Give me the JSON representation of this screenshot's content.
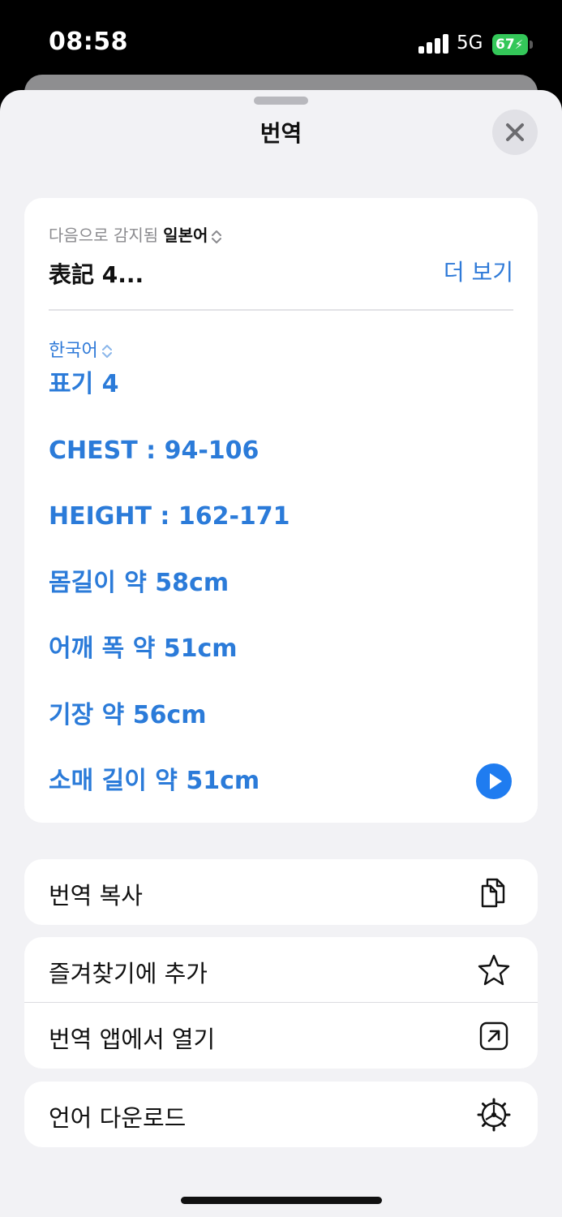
{
  "status": {
    "time": "08:58",
    "network": "5G",
    "battery": "67"
  },
  "sheet": {
    "title": "번역"
  },
  "source": {
    "detected_prefix": "다음으로 감지됨",
    "detected_language": "일본어",
    "text": "表記 4...",
    "more_label": "더 보기"
  },
  "target": {
    "language": "한국어",
    "lines": [
      "표기 4",
      "CHEST : 94-106",
      "HEIGHT : 162-171",
      "몸길이 약 58cm",
      "어깨 폭 약 51cm",
      "기장 약 56cm",
      "소매 길이 약 51cm"
    ]
  },
  "actions": {
    "copy": "번역 복사",
    "favorite": "즐겨찾기에 추가",
    "open_app": "번역 앱에서 열기",
    "download": "언어 다운로드"
  },
  "icons": {
    "close": "close-icon",
    "play": "play-icon",
    "copy": "copy-icon",
    "star": "star-icon",
    "open": "open-external-icon",
    "download": "gear-download-icon"
  },
  "colors": {
    "accent": "#2b7bd9",
    "battery": "#34c759"
  }
}
